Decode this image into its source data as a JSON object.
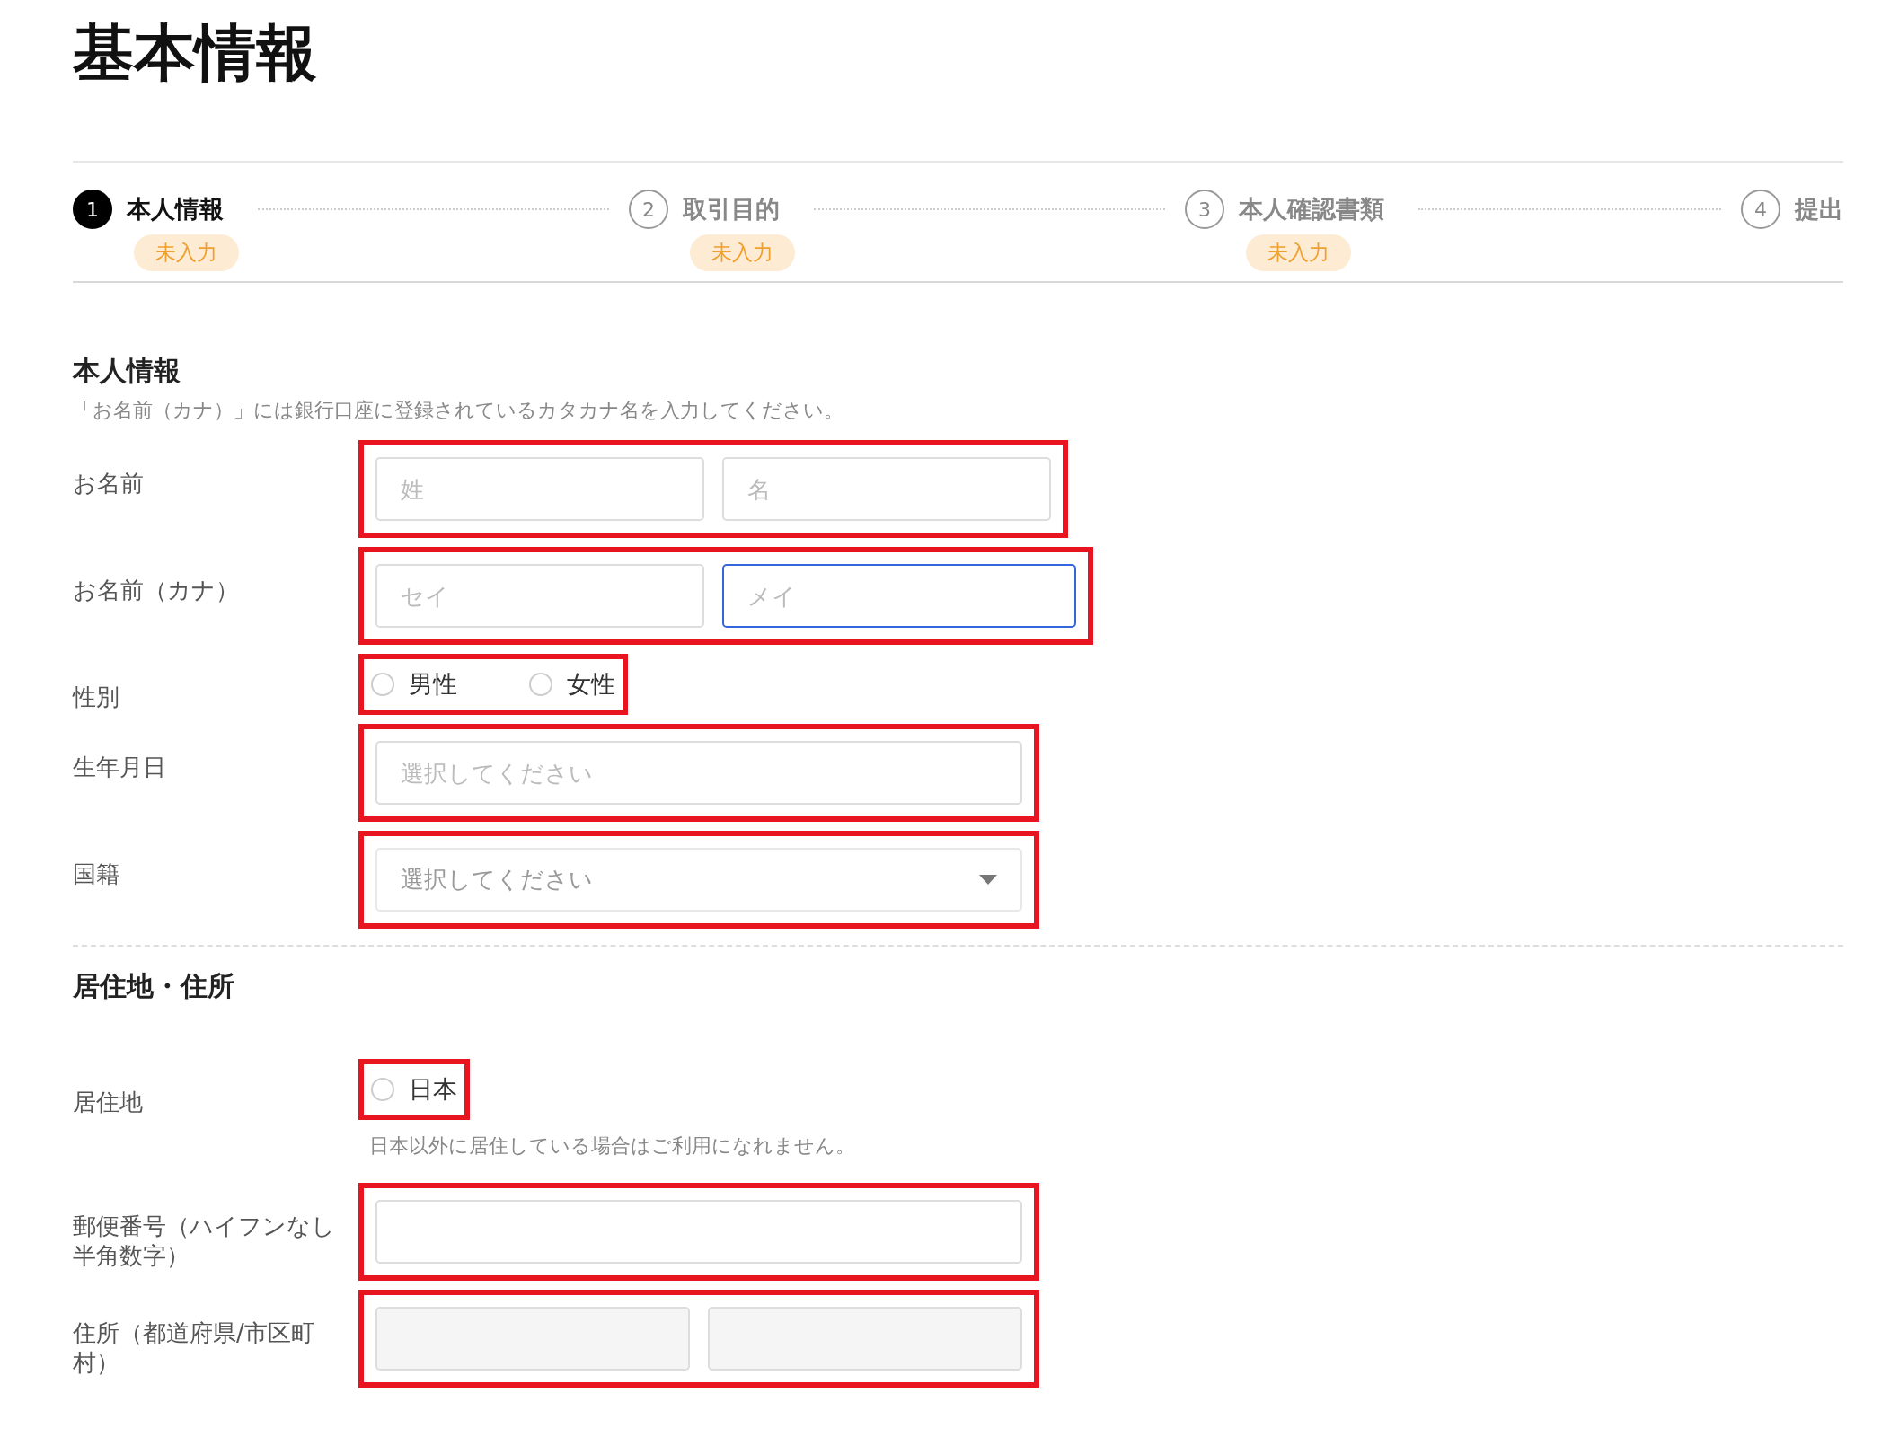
{
  "page_title": "基本情報",
  "steps": [
    {
      "number": "1",
      "label": "本人情報",
      "status": "未入力",
      "selected": true
    },
    {
      "number": "2",
      "label": "取引目的",
      "status": "未入力",
      "selected": false
    },
    {
      "number": "3",
      "label": "本人確認書類",
      "status": "未入力",
      "selected": false
    },
    {
      "number": "4",
      "label": "提出",
      "selected": false
    }
  ],
  "sections": [
    {
      "heading": "本人情報",
      "note": "「お名前（カナ）」には銀行口座に登録されているカタカナ名を入力してください。",
      "rows": [
        {
          "kind": "fields",
          "label": "お名前",
          "highlighted": true,
          "fields": [
            {
              "placeholder": "姓",
              "focused": false,
              "disabled": false
            },
            {
              "placeholder": "名",
              "focused": false,
              "disabled": false
            }
          ]
        },
        {
          "kind": "fields",
          "label": "お名前（カナ）",
          "highlighted": true,
          "fields": [
            {
              "placeholder": "セイ",
              "focused": false,
              "disabled": false
            },
            {
              "placeholder": "メイ",
              "focused": true,
              "disabled": false
            }
          ]
        },
        {
          "kind": "radio",
          "label": "性別",
          "highlighted": true,
          "options": [
            {
              "label": "男性",
              "selected": false
            },
            {
              "label": "女性",
              "selected": false
            }
          ]
        },
        {
          "kind": "fields",
          "label": "生年月日",
          "highlighted": true,
          "fields": [
            {
              "placeholder": "選択してください",
              "focused": false,
              "disabled": false
            }
          ]
        },
        {
          "kind": "select",
          "label": "国籍",
          "highlighted": true,
          "placeholder": "選択してください"
        }
      ]
    },
    {
      "heading": "居住地・住所",
      "rows": [
        {
          "kind": "radio",
          "label": "居住地",
          "highlighted": true,
          "options": [
            {
              "label": "日本",
              "selected": false
            }
          ],
          "help": "日本以外に居住している場合はご利用になれません。"
        },
        {
          "kind": "fields",
          "label": "郵便番号（ハイフンなし半角数字）",
          "highlighted": true,
          "fields": [
            {
              "focused": false,
              "disabled": false
            }
          ]
        },
        {
          "kind": "fields",
          "label": "住所（都道府県/市区町村）",
          "highlighted": true,
          "fields": [
            {
              "focused": false,
              "disabled": true
            },
            {
              "focused": false,
              "disabled": true
            }
          ]
        }
      ]
    }
  ]
}
